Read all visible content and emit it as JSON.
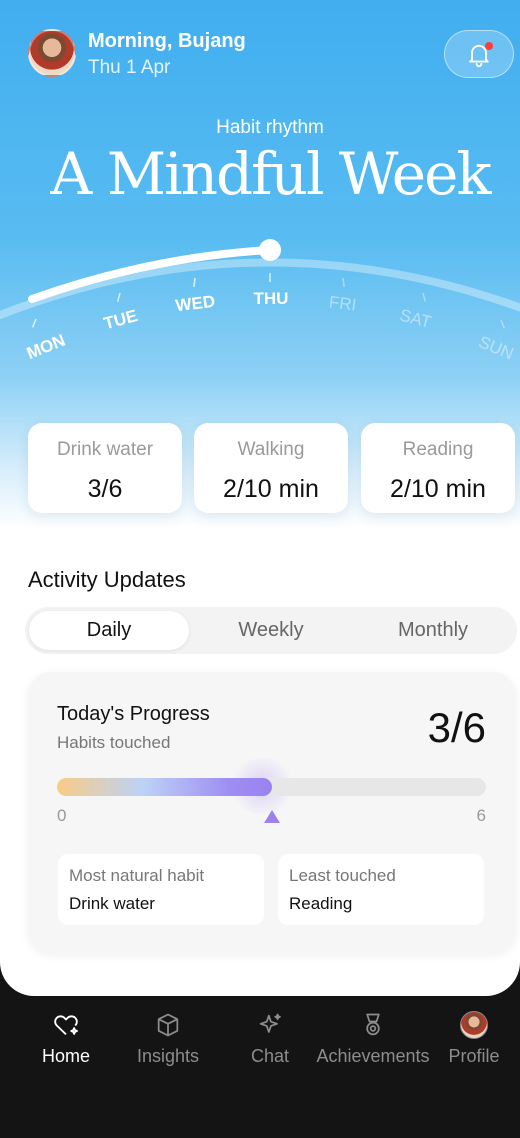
{
  "header": {
    "greeting": "Morning, Bujang",
    "date": "Thu 1 Apr",
    "avatar_icon": "user-avatar",
    "notification_icon": "bell-icon",
    "notification_dot_color": "#ff3b3b"
  },
  "hero": {
    "subtitle": "Habit rhythm",
    "title": "A Mindful Week"
  },
  "week_dial": {
    "days": [
      "MON",
      "TUE",
      "WED",
      "THU",
      "FRI",
      "SAT",
      "SUN"
    ],
    "current_day": "THU",
    "current_index": 3
  },
  "stats": [
    {
      "label": "Drink water",
      "value": "3/6"
    },
    {
      "label": "Walking",
      "value": "2/10 min"
    },
    {
      "label": "Reading",
      "value": "2/10 min"
    }
  ],
  "activity": {
    "title": "Activity Updates",
    "tabs": [
      "Daily",
      "Weekly",
      "Monthly"
    ],
    "active_tab": "Daily"
  },
  "progress": {
    "title": "Today's Progress",
    "subtitle": "Habits touched",
    "value": "3/6",
    "current": 3,
    "min": "0",
    "max": "6",
    "fraction": 0.5,
    "gradient_colors": [
      "#f8cc87",
      "#bcd2f6",
      "#9f8ef2"
    ],
    "marker_color": "#9b82ee"
  },
  "highlights": [
    {
      "label": "Most natural habit",
      "value": "Drink water"
    },
    {
      "label": "Least touched",
      "value": "Reading"
    }
  ],
  "nav": {
    "items": [
      {
        "label": "Home",
        "icon": "heart-sparkle-icon",
        "active": true
      },
      {
        "label": "Insights",
        "icon": "cube-icon",
        "active": false
      },
      {
        "label": "Chat",
        "icon": "sparkle-icon",
        "active": false
      },
      {
        "label": "Achievements",
        "icon": "medal-icon",
        "active": false
      },
      {
        "label": "Profile",
        "icon": "profile-avatar",
        "active": false
      }
    ]
  }
}
